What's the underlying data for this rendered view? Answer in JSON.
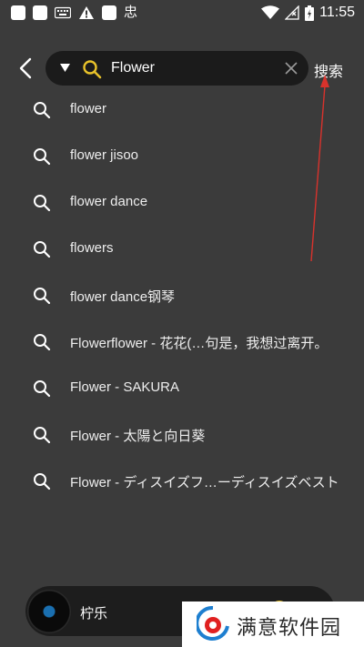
{
  "status_bar": {
    "time": "11:55",
    "icons": [
      "notification-box-icon",
      "notification-box-icon",
      "keyboard-icon",
      "warning-icon",
      "notification-box-icon",
      "app-icon",
      "wifi-icon",
      "no-signal-icon",
      "battery-icon"
    ],
    "app_glyph": "忠"
  },
  "search": {
    "query": "Flower",
    "submit_label": "搜索"
  },
  "suggestions": [
    "flower",
    "flower jisoo",
    "flower dance",
    "flowers",
    "flower dance钢琴",
    "Flowerflower - 花花(…句是，我想过离开。",
    "Flower - SAKURA",
    "Flower - 太陽と向日葵",
    "Flower - ディスイズフ…ーディスイズベスト"
  ],
  "player": {
    "title": "柠乐"
  },
  "watermark": {
    "text": "满意软件园"
  },
  "colors": {
    "background": "#3b3b3b",
    "search_bar": "#1b1b1b",
    "accent_yellow": "#e8c22a",
    "annotation_red": "#d8322c"
  }
}
